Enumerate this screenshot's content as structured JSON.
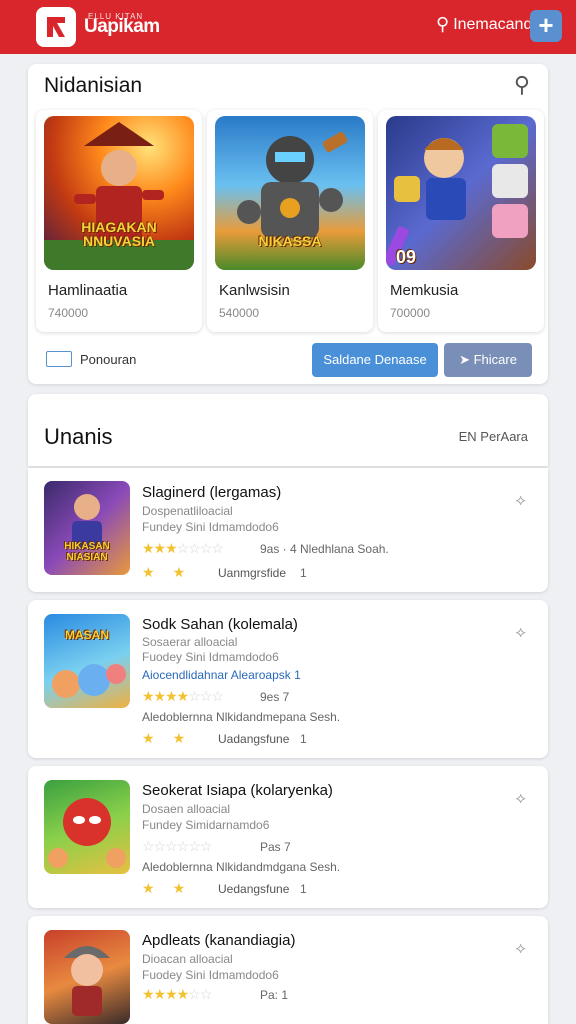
{
  "header": {
    "brand": "Uapikam",
    "brand_small": "ELLU KITAN",
    "search_label": "Inemacand",
    "add_glyph": "+",
    "bg_color": "#d9262c"
  },
  "featured": {
    "title": "Nidanisian",
    "items": [
      {
        "name": "Hamlinaatia",
        "count": "740000",
        "art_text": "HIAGAKAN NNUVASIA"
      },
      {
        "name": "Kanlwsisin",
        "count": "540000",
        "art_text": "NIKASSA"
      },
      {
        "name": "Memkusia",
        "count": "700000",
        "art_text": "09"
      }
    ],
    "footer_label": "Ponouran",
    "btn_primary": "Saldane Denaase",
    "btn_secondary": "Fhicare"
  },
  "list": {
    "title": "Unanis",
    "filter": "EN PerAara",
    "rows": [
      {
        "title": "Slaginerd (lergamas)",
        "sub1": "Dospenatliloacial",
        "sub2": "Fundey Sini Idmamdodo6",
        "rating_meta": "9as · 4 Nledhlana Soah.",
        "small_label": "Uanmgrsfide",
        "small_count": "1",
        "thumb_text": "HIKASAN NIASIAN"
      },
      {
        "title": "Sodk Sahan (kolemala)",
        "sub1": "Sosaerar alloacial",
        "sub2": "Fuodey Sini Idmamdodo6",
        "link": "Aiocendlidahnar Alearoapsk 1",
        "rating_meta": "9es 7",
        "desc": "Aledoblernna Nlkidandmepana Sesh.",
        "small_label": "Uadangsfune",
        "small_count": "1",
        "thumb_text": "MASAN"
      },
      {
        "title": "Seokerat Isiapa (kolaryenka)",
        "sub1": "Dosaen alloacial",
        "sub2": "Fundey Simidarnamdo6",
        "rating_meta": "Pas 7",
        "desc": "Aledoblernna Nlkidandmdgana Sesh.",
        "small_label": "Uedangsfune",
        "small_count": "1",
        "thumb_text": ""
      },
      {
        "title": "Apdleats (kanandiagia)",
        "sub1": "Dioacan alloacial",
        "sub2": "Fuodey Sini Idmamdodo6",
        "rating_meta": "Pa: 1",
        "thumb_text": ""
      }
    ]
  }
}
